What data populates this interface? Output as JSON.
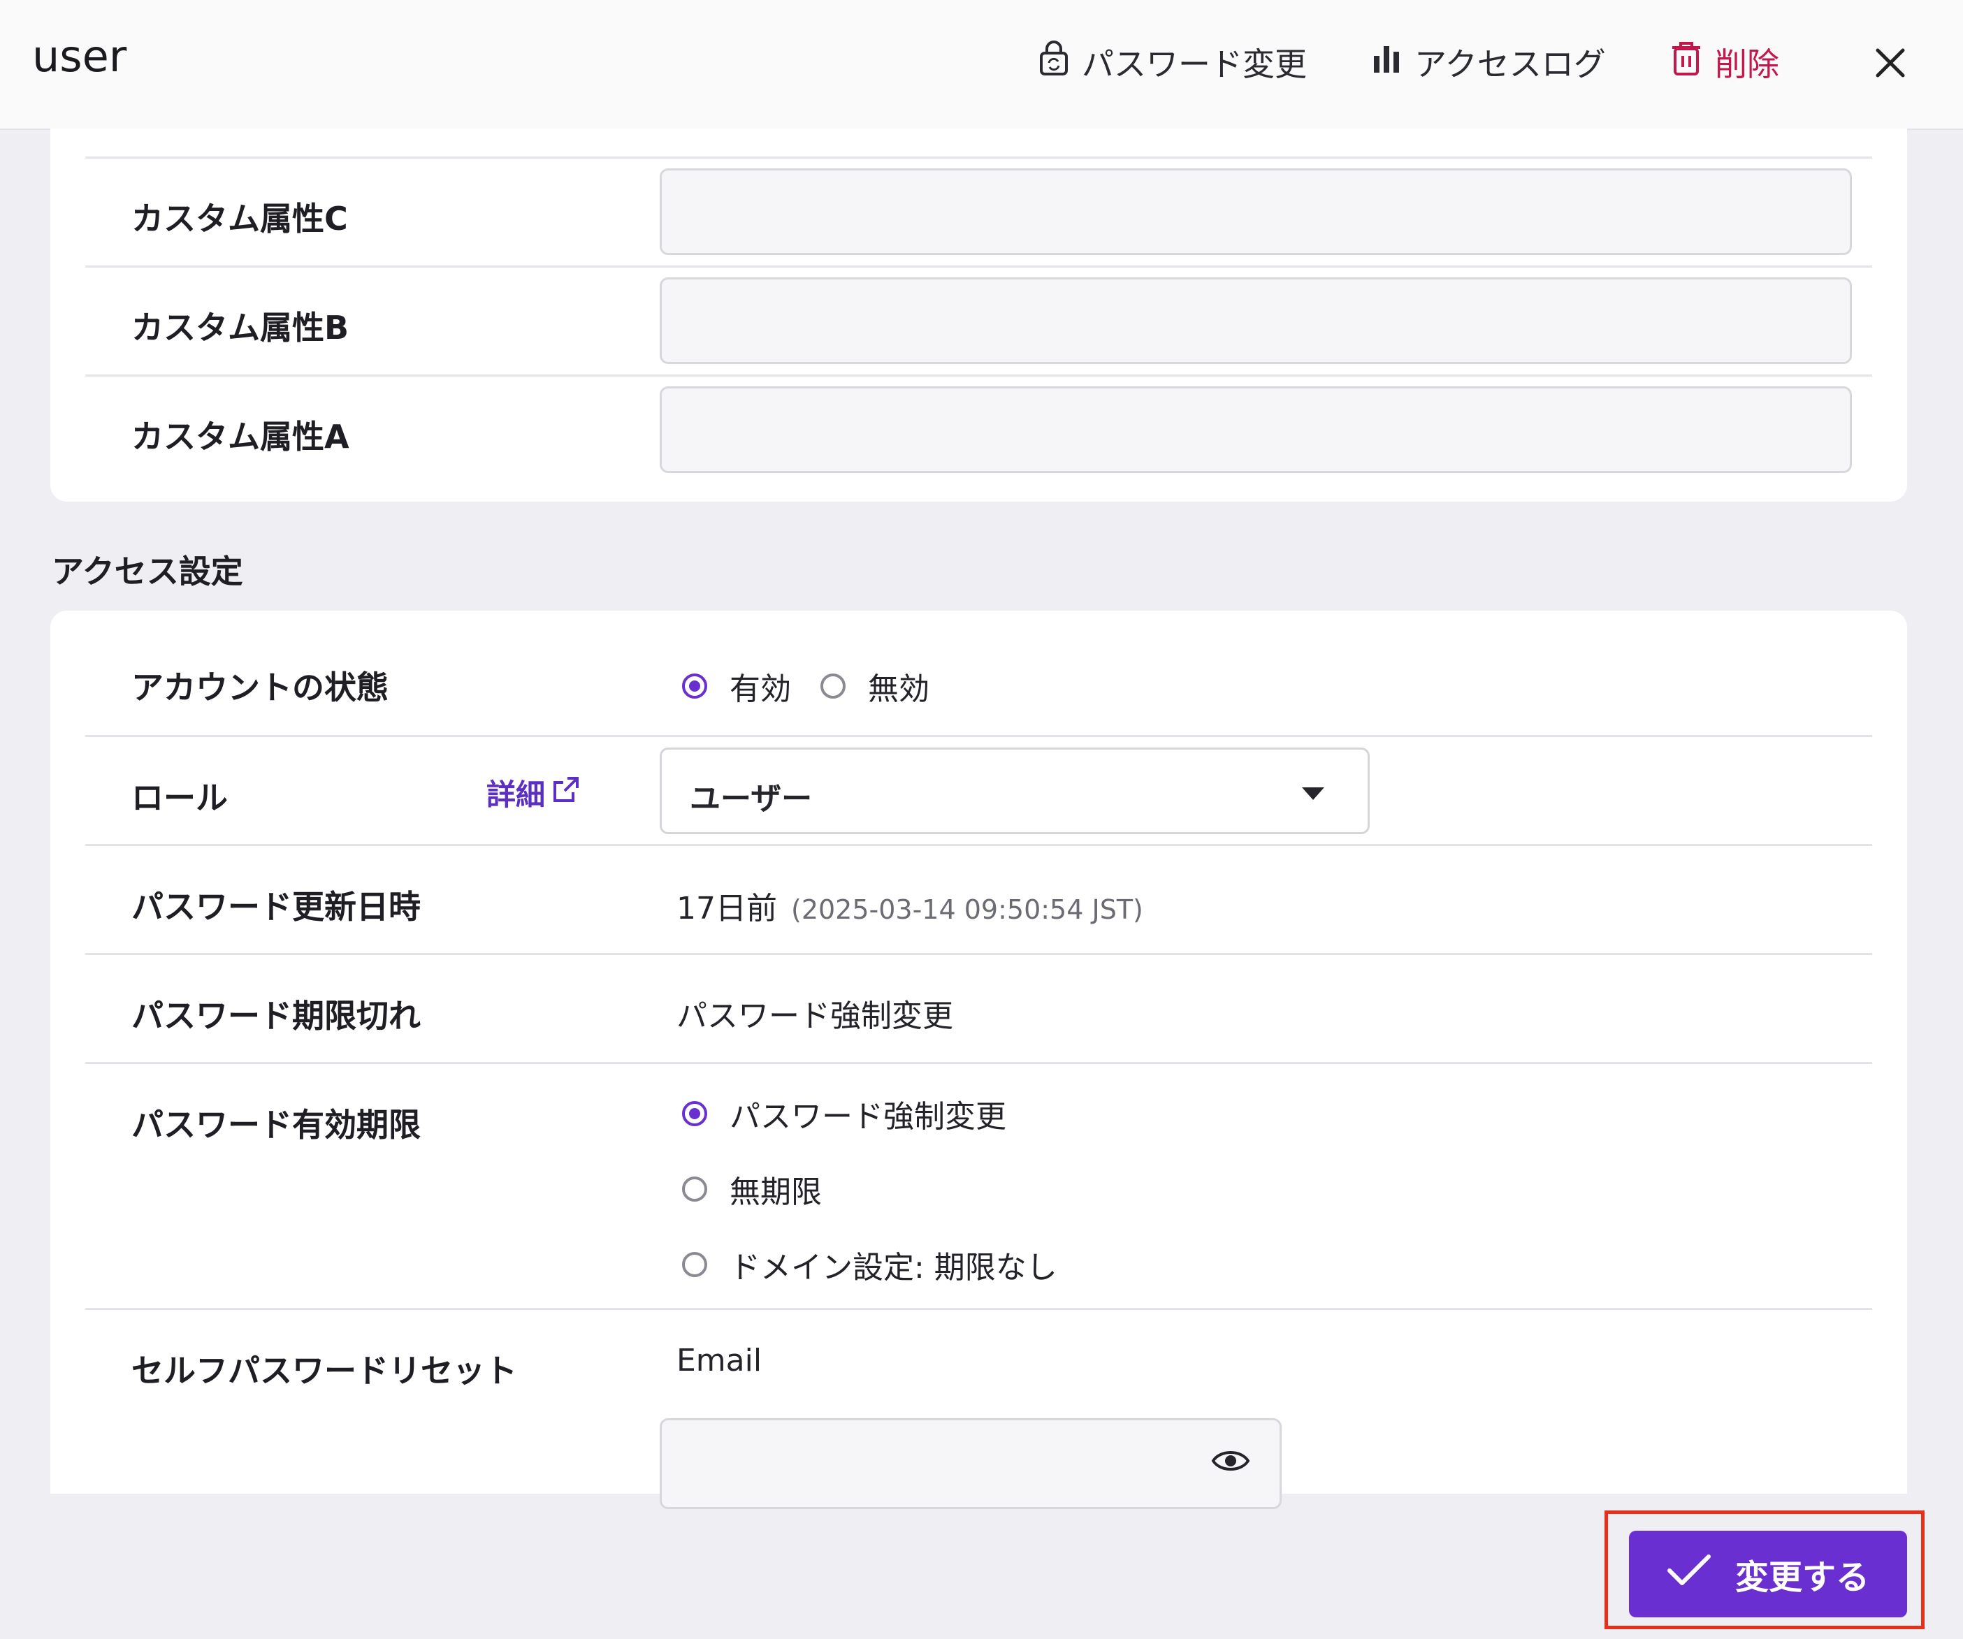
{
  "header": {
    "title": "user",
    "password_change_label": "パスワード変更",
    "access_log_label": "アクセスログ",
    "delete_label": "削除",
    "danger_color": "#c2184b"
  },
  "custom_attributes": [
    {
      "label": "カスタム属性C",
      "value": ""
    },
    {
      "label": "カスタム属性B",
      "value": ""
    },
    {
      "label": "カスタム属性A",
      "value": ""
    }
  ],
  "access_settings": {
    "section_title": "アクセス設定",
    "account_status": {
      "label": "アカウントの状態",
      "options": [
        "有効",
        "無効"
      ],
      "selected": "有効"
    },
    "role": {
      "label": "ロール",
      "detail_link": "詳細",
      "selected": "ユーザー"
    },
    "password_updated": {
      "label": "パスワード更新日時",
      "relative": "17日前",
      "absolute": "(2025-03-14 09:50:54 JST)"
    },
    "password_expired": {
      "label": "パスワード期限切れ",
      "value": "パスワード強制変更"
    },
    "password_validity": {
      "label": "パスワード有効期限",
      "options": [
        "パスワード強制変更",
        "無期限",
        "ドメイン設定: 期限なし"
      ],
      "selected": "パスワード強制変更"
    },
    "self_password_reset": {
      "label": "セルフパスワードリセット",
      "method": "Email",
      "input_value": ""
    }
  },
  "submit": {
    "label": "変更する",
    "color": "#6a2fd0",
    "highlight_color": "#e5311c"
  }
}
